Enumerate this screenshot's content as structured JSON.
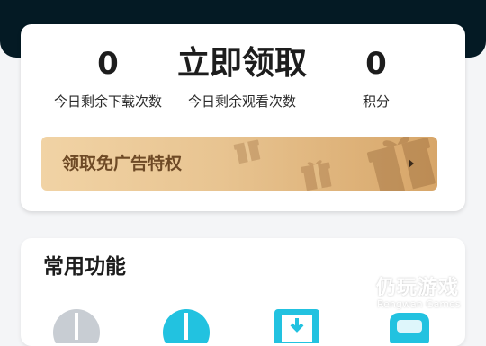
{
  "stats": [
    {
      "value": "0",
      "label": "今日剩余下载次数"
    },
    {
      "value": "立即领取",
      "label": "今日剩余观看次数"
    },
    {
      "value": "0",
      "label": "积分"
    }
  ],
  "banner": {
    "text": "领取免广告特权"
  },
  "functions": {
    "title": "常用功能"
  },
  "watermark": {
    "text": "仍玩游戏",
    "subtext": "Rengwan Games"
  },
  "colors": {
    "header": "#041a24",
    "banner_start": "#f1d3a5",
    "banner_end": "#d7a669",
    "banner_text": "#6e4a26",
    "icon_cyan": "#22c2e0",
    "icon_grey": "#c8cdd3"
  },
  "icons": [
    "gift-icon",
    "play-arrow-icon",
    "download-icon",
    "watermark-logo-icon"
  ]
}
